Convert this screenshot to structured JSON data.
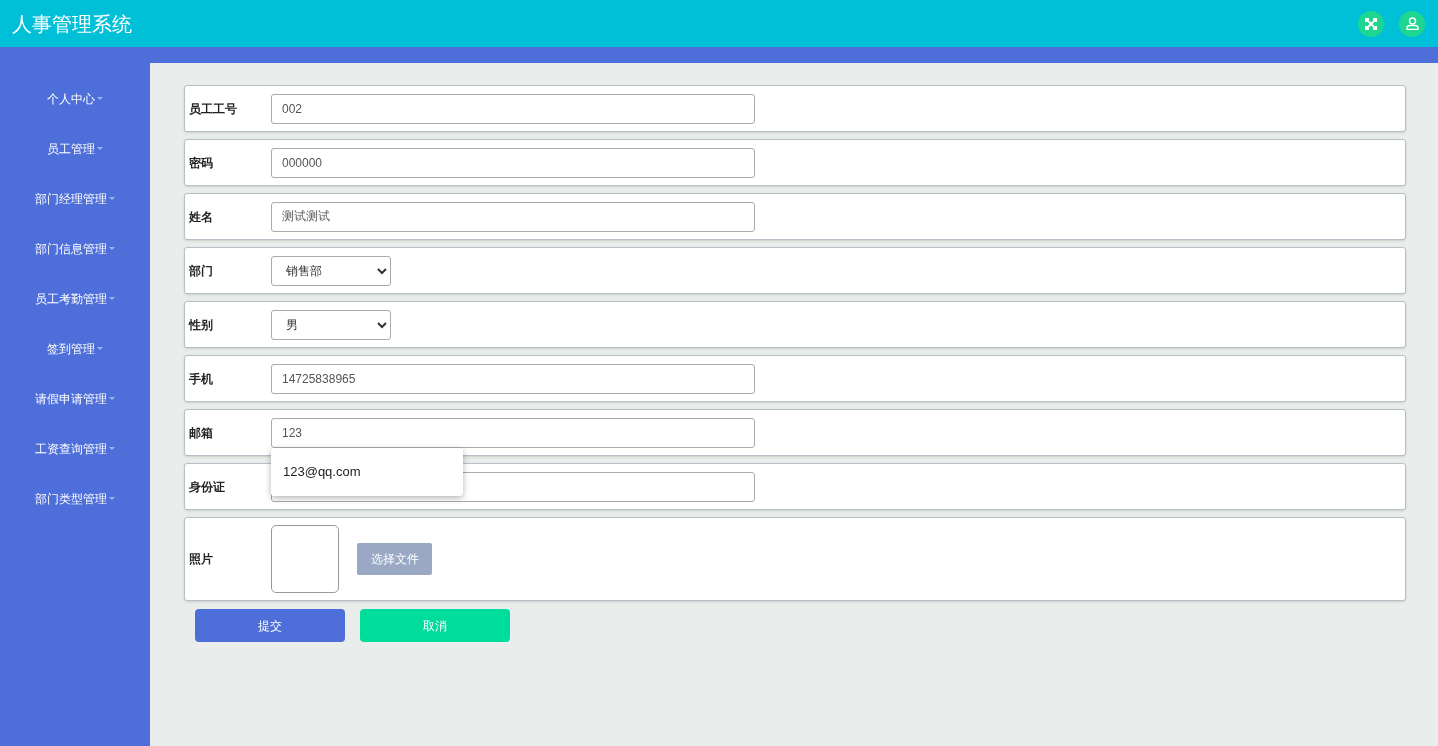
{
  "header": {
    "title": "人事管理系统"
  },
  "sidebar": {
    "items": [
      {
        "label": "个人中心"
      },
      {
        "label": "员工管理"
      },
      {
        "label": "部门经理管理"
      },
      {
        "label": "部门信息管理"
      },
      {
        "label": "员工考勤管理"
      },
      {
        "label": "签到管理"
      },
      {
        "label": "请假申请管理"
      },
      {
        "label": "工资查询管理"
      },
      {
        "label": "部门类型管理"
      }
    ]
  },
  "form": {
    "fields": [
      {
        "kind": "text",
        "label": "员工工号",
        "value": "002"
      },
      {
        "kind": "text",
        "label": "密码",
        "value": "000000"
      },
      {
        "kind": "text",
        "label": "姓名",
        "value": "测试测试"
      },
      {
        "kind": "select",
        "label": "部门",
        "value": "销售部"
      },
      {
        "kind": "select",
        "label": "性别",
        "value": "男"
      },
      {
        "kind": "text",
        "label": "手机",
        "value": "14725838965"
      },
      {
        "kind": "text",
        "label": "邮箱",
        "value": "123",
        "suggestions": [
          "123@qq.com"
        ]
      },
      {
        "kind": "text",
        "label": "身份证"
      },
      {
        "kind": "image",
        "label": "照片",
        "button": "选择文件"
      }
    ],
    "buttons": [
      {
        "kind": "primary",
        "label": "提交"
      },
      {
        "kind": "secondary",
        "label": "取消"
      }
    ]
  }
}
